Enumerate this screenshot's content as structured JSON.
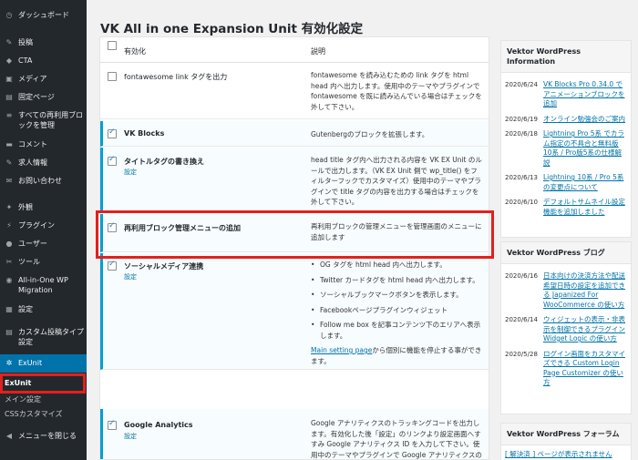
{
  "sidebar": {
    "items": [
      {
        "icon": "dashboard-icon",
        "glyph": "◷",
        "label": "ダッシュボード"
      },
      {
        "icon": "pin-icon",
        "glyph": "✎",
        "label": "投稿"
      },
      {
        "icon": "megaphone-icon",
        "glyph": "◆",
        "label": "CTA"
      },
      {
        "icon": "media-icon",
        "glyph": "▣",
        "label": "メディア"
      },
      {
        "icon": "page-icon",
        "glyph": "▤",
        "label": "固定ページ"
      },
      {
        "icon": "reusable-block-icon",
        "glyph": "≡",
        "label": "すべての再利用ブロックを管理"
      },
      {
        "icon": "comment-icon",
        "glyph": "▬",
        "label": "コメント"
      },
      {
        "icon": "job-icon",
        "glyph": "✎",
        "label": "求人情報"
      },
      {
        "icon": "mail-icon",
        "glyph": "✉",
        "label": "お問い合わせ"
      },
      {
        "icon": "appearance-icon",
        "glyph": "✦",
        "label": "外観"
      },
      {
        "icon": "plugin-icon",
        "glyph": "⚡",
        "label": "プラグイン"
      },
      {
        "icon": "user-icon",
        "glyph": "●",
        "label": "ユーザー"
      },
      {
        "icon": "tools-icon",
        "glyph": "✂",
        "label": "ツール"
      },
      {
        "icon": "migration-icon",
        "glyph": "◉",
        "label": "All-in-One WP Migration"
      },
      {
        "icon": "settings-icon",
        "glyph": "▦",
        "label": "設定"
      },
      {
        "icon": "custom-post-icon",
        "glyph": "▤",
        "label": "カスタム投稿タイプ設定"
      },
      {
        "icon": "gear-icon",
        "glyph": "✲",
        "label": "ExUnit"
      }
    ],
    "submenu": [
      "ExUnit",
      "メイン設定",
      "CSSカスタマイズ"
    ],
    "collapse": {
      "icon": "collapse-icon",
      "glyph": "◀",
      "label": "メニューを閉じる"
    }
  },
  "page": {
    "title": "VK All in one Expansion Unit 有効化設定"
  },
  "table": {
    "col_enable": "有効化",
    "col_desc": "説明",
    "rows": [
      {
        "name": "fontawesome link タグを出力",
        "checked": false,
        "desc": "fontawesome を読み込むための link タグを html head 内へ出力します。使用中のテーマやプラグインで fontawesome を既に読み込んでいる場合はチェックを外して下さい。"
      },
      {
        "name": "VK Blocks",
        "checked": true,
        "desc": "Gutenbergのブロックを拡張します。"
      },
      {
        "name": "タイトルタグの書き換え",
        "checked": true,
        "settings": "設定",
        "desc": "head title タグ内へ出力される内容を VK EX Unit のルールで出力します。（VK EX Unit 側で wp_title() をフィルターフックでカスタマイズ）使用中のテーマやプラグインで title タグの内容を出力する場合はチェックを外して下さい。"
      },
      {
        "name": "再利用ブロック管理メニューの追加",
        "checked": true,
        "desc": "再利用ブロックの管理メニューを管理画面のメニューに追加します"
      },
      {
        "name": "ソーシャルメディア連携",
        "checked": true,
        "settings": "設定",
        "bullets": [
          "OG タグを html head 内へ出力します。",
          "Twitter カードタグを html head 内へ出力します。",
          "ソーシャルブックマークボタンを表示します。",
          "Facebookページプラグインウィジェット",
          "Follow me box を記事コンテンツ下のエリアへ表示します。"
        ],
        "link": "Main setting page",
        "after_link": "から個別に機能を停止する事ができます。"
      },
      {
        "name": "Google Analytics",
        "checked": true,
        "settings": "設定",
        "desc": "Google アナリティクスのトラッキングコードを出力します。有効化した後「設定」のリンクより設定画面へすすみ Google アナリティクス ID を入力して下さい。使用中のテーマやプラグインで Google アナリティクスのトラッキングコードを出力する場合はチェックを外して下さい。"
      }
    ]
  },
  "widgets": {
    "info": {
      "title": "Vektor WordPress Information",
      "items": [
        {
          "date": "2020/6/24",
          "text": "VK Blocks Pro 0.34.0 でアニメーションブロックを追加"
        },
        {
          "date": "2020/6/19",
          "text": "オンライン勉強会のご案内"
        },
        {
          "date": "2020/6/18",
          "text": "Lightning Pro 5系 でカラム指定の不具合と無料版10系 / Pro版5系の仕様解説"
        },
        {
          "date": "2020/6/13",
          "text": "Lightning 10系 / Pro 5系の変更点について"
        },
        {
          "date": "2020/6/10",
          "text": "デフォルトサムネイル設定機能を追加しました"
        }
      ]
    },
    "blog": {
      "title": "Vektor WordPress ブログ",
      "items": [
        {
          "date": "2020/6/16",
          "text": "日本向けの決済方法や配送希望日時の設定を追加できる Japanized For WooCommerce の使い方"
        },
        {
          "date": "2020/6/14",
          "text": "ウィジェットの表示・非表示を制御できるプラグイン Widget Logic の使い方"
        },
        {
          "date": "2020/5/28",
          "text": "ログイン画面をカスタマイズできる Custom Login Page Customizer の使い方"
        }
      ]
    },
    "forum": {
      "title": "Vektor WordPress フォーラム",
      "first_item": "[ 解決済 ] ページが表示されません"
    }
  }
}
